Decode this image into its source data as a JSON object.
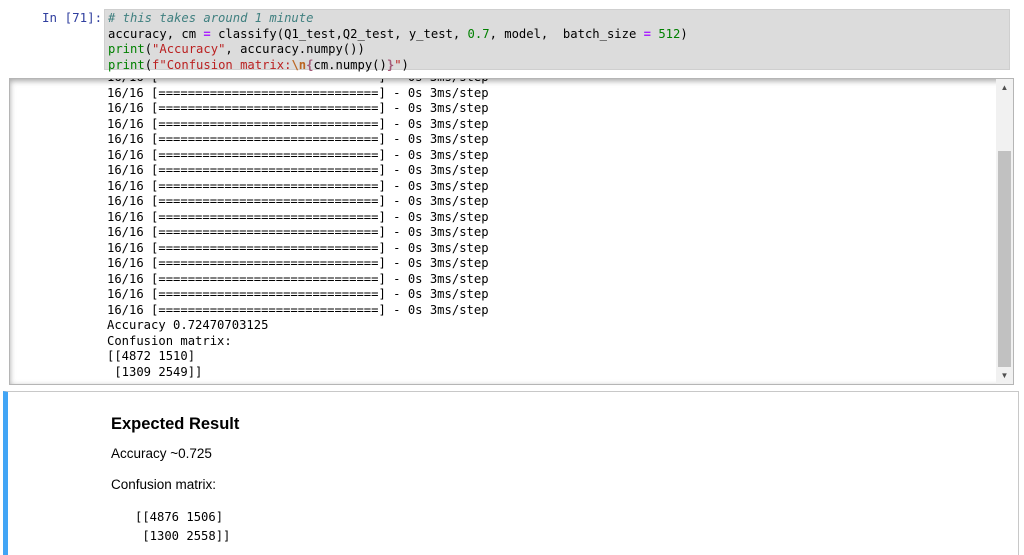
{
  "code_cell": {
    "prompt": "In [71]:",
    "lines": [
      [
        {
          "t": "comment",
          "v": "# this takes around 1 minute"
        }
      ],
      [
        {
          "t": "plain",
          "v": "accuracy, cm "
        },
        {
          "t": "op",
          "v": "="
        },
        {
          "t": "plain",
          "v": " classify(Q1_test,Q2_test, y_test, "
        },
        {
          "t": "num",
          "v": "0.7"
        },
        {
          "t": "plain",
          "v": ", model,  batch_size "
        },
        {
          "t": "op",
          "v": "="
        },
        {
          "t": "plain",
          "v": " "
        },
        {
          "t": "num",
          "v": "512"
        },
        {
          "t": "plain",
          "v": ")"
        }
      ],
      [
        {
          "t": "builtin",
          "v": "print"
        },
        {
          "t": "plain",
          "v": "("
        },
        {
          "t": "str",
          "v": "\"Accuracy\""
        },
        {
          "t": "plain",
          "v": ", accuracy.numpy())"
        }
      ],
      [
        {
          "t": "builtin",
          "v": "print"
        },
        {
          "t": "plain",
          "v": "("
        },
        {
          "t": "str",
          "v": "f\"Confusion matrix:"
        },
        {
          "t": "esc",
          "v": "\\n"
        },
        {
          "t": "interp",
          "v": "{"
        },
        {
          "t": "plain",
          "v": "cm.numpy()"
        },
        {
          "t": "interp",
          "v": "}"
        },
        {
          "t": "str",
          "v": "\""
        },
        {
          "t": "plain",
          "v": ")"
        }
      ]
    ]
  },
  "output": {
    "lines": [
      "16/16 [==============================] - 0s 3ms/step",
      "16/16 [==============================] - 0s 3ms/step",
      "16/16 [==============================] - 0s 3ms/step",
      "16/16 [==============================] - 0s 3ms/step",
      "16/16 [==============================] - 0s 3ms/step",
      "16/16 [==============================] - 0s 3ms/step",
      "16/16 [==============================] - 0s 3ms/step",
      "16/16 [==============================] - 0s 3ms/step",
      "16/16 [==============================] - 0s 3ms/step",
      "16/16 [==============================] - 0s 3ms/step",
      "16/16 [==============================] - 0s 3ms/step",
      "16/16 [==============================] - 0s 3ms/step",
      "16/16 [==============================] - 0s 3ms/step",
      "16/16 [==============================] - 0s 3ms/step",
      "16/16 [==============================] - 0s 3ms/step",
      "16/16 [==============================] - 0s 3ms/step",
      "Accuracy 0.72470703125",
      "Confusion matrix:",
      "[[4872 1510]",
      " [1309 2549]]"
    ],
    "scroll_up_glyph": "▲",
    "scroll_down_glyph": "▼"
  },
  "markdown_cell": {
    "heading": "Expected Result",
    "accuracy": "Accuracy ~0.725",
    "cm_label": "Confusion matrix:",
    "matrix_row1": "[[4876 1506]",
    "matrix_row2": " [1300 2558]]"
  },
  "colors": {
    "prompt": "#303f9f",
    "code_bg": "#dcdcdc",
    "markdown_accent": "#42a5f5",
    "scrollbar_thumb": "#c1c1c1"
  }
}
